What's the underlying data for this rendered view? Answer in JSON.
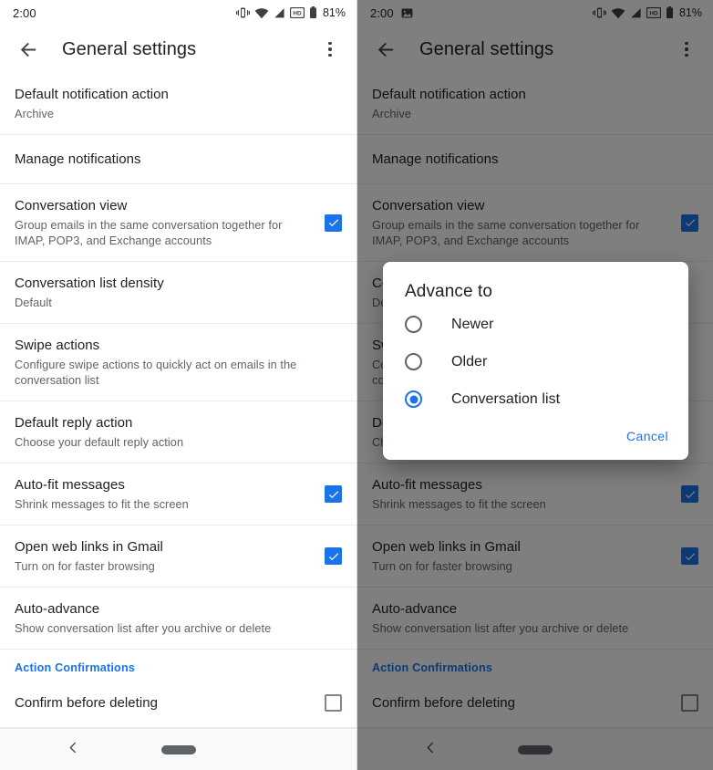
{
  "status_bar": {
    "time": "2:00",
    "battery_percent": "81%",
    "icons_left_dark": [
      "screenshot-image-icon"
    ],
    "icons_right": [
      "vibrate-icon",
      "wifi-icon",
      "signal-icon",
      "hd-icon",
      "battery-icon"
    ]
  },
  "toolbar": {
    "title": "General settings",
    "back_icon": "back-arrow-icon",
    "overflow_icon": "more-vert-icon"
  },
  "settings": {
    "rows": [
      {
        "title": "Default notification action",
        "sub": "Archive",
        "control": "none"
      },
      {
        "title": "Manage notifications",
        "sub": "",
        "control": "none"
      },
      {
        "title": "Conversation view",
        "sub": "Group emails in the same conversation together for IMAP, POP3, and Exchange accounts",
        "control": "checkbox",
        "checked": true
      },
      {
        "title": "Conversation list density",
        "sub": "Default",
        "control": "none"
      },
      {
        "title": "Swipe actions",
        "sub": "Configure swipe actions to quickly act on emails in the conversation list",
        "control": "none"
      },
      {
        "title": "Default reply action",
        "sub": "Choose your default reply action",
        "control": "none"
      },
      {
        "title": "Auto-fit messages",
        "sub": "Shrink messages to fit the screen",
        "control": "checkbox",
        "checked": true
      },
      {
        "title": "Open web links in Gmail",
        "sub": "Turn on for faster browsing",
        "control": "checkbox",
        "checked": true
      },
      {
        "title": "Auto-advance",
        "sub": "Show conversation list after you archive or delete",
        "control": "none"
      }
    ],
    "section_header": "Action Confirmations",
    "confirm_row": {
      "title": "Confirm before deleting",
      "control": "checkbox",
      "checked": false
    }
  },
  "dialog": {
    "title": "Advance to",
    "options": [
      {
        "label": "Newer",
        "selected": false
      },
      {
        "label": "Older",
        "selected": false
      },
      {
        "label": "Conversation list",
        "selected": true
      }
    ],
    "cancel_label": "Cancel"
  },
  "nav_bar": {
    "back_icon": "nav-back-chevron-icon",
    "home_pill": "home-pill-indicator"
  },
  "colors": {
    "accent_blue": "#1a73e8",
    "text_primary": "#202124",
    "text_secondary": "#5f6368",
    "divider": "#e8eaed",
    "scrim": "rgba(0,0,0,0.50)"
  }
}
